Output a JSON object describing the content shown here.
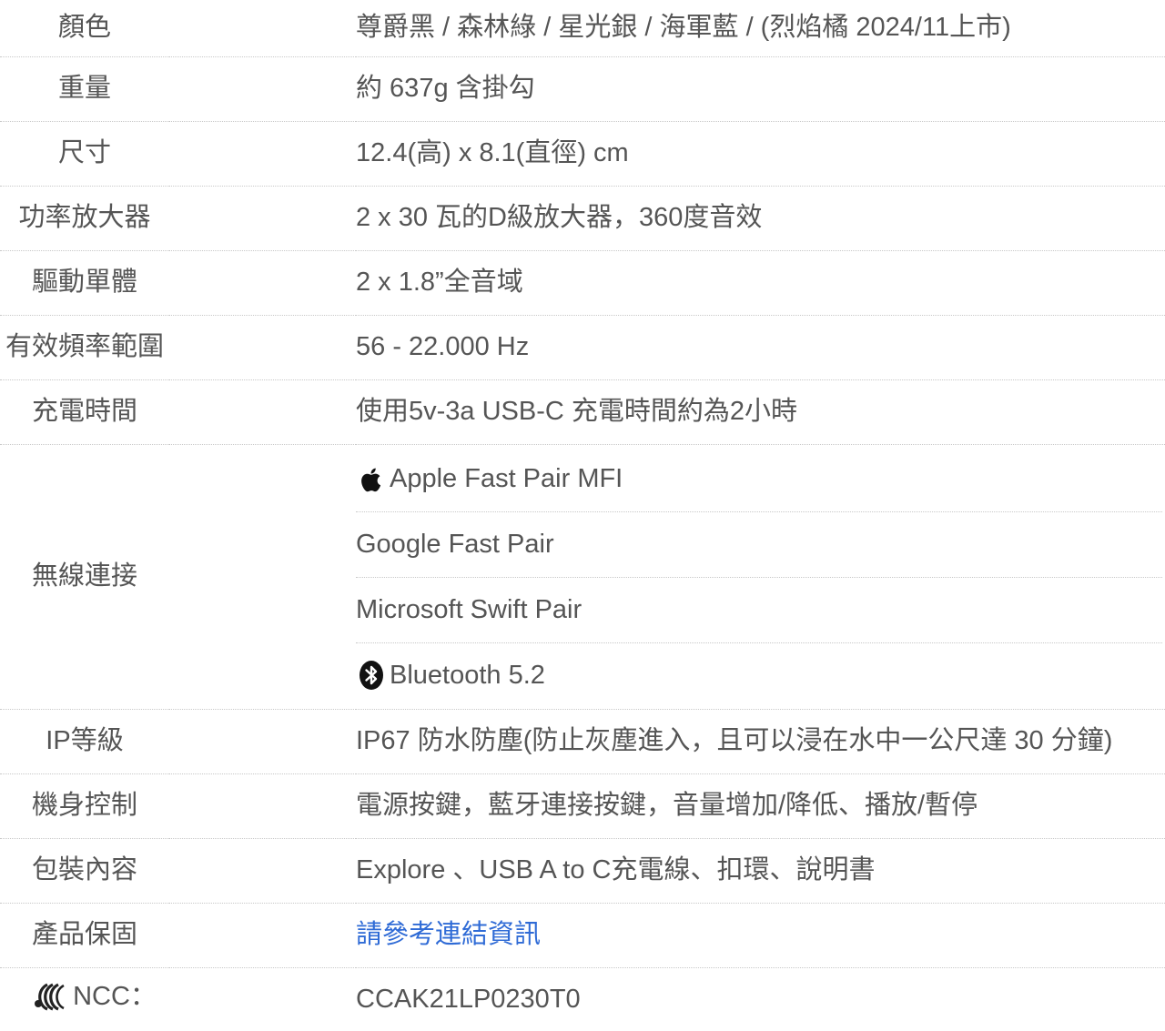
{
  "specs": [
    {
      "label": "顏色",
      "value": "尊爵黑 / 森林綠 / 星光銀 / 海軍藍 / (烈焰橘 2024/11上市)"
    },
    {
      "label": "重量",
      "value": "約 637g 含掛勾"
    },
    {
      "label": "尺寸",
      "value": "12.4(高) x 8.1(直徑) cm"
    },
    {
      "label": "功率放大器",
      "value": "2 x 30 瓦的D級放大器，360度音效"
    },
    {
      "label": "驅動單體",
      "value": "2 x 1.8”全音域"
    },
    {
      "label": "有效頻率範圍",
      "value": "56 - 22.000 Hz"
    },
    {
      "label": "充電時間",
      "value": "使用5v-3a USB-C 充電時間約為2小時"
    }
  ],
  "wireless": {
    "label": "無線連接",
    "items": [
      {
        "text": "Apple Fast Pair MFI",
        "icon": "apple-icon"
      },
      {
        "text": "Google Fast Pair"
      },
      {
        "text": "Microsoft Swift Pair"
      },
      {
        "text": "Bluetooth 5.2",
        "icon": "bluetooth-icon"
      }
    ]
  },
  "specs2": [
    {
      "label": "IP等級",
      "value": "IP67 防水防塵(防止灰塵進入，且可以浸在水中一公尺達 30 分鐘)"
    },
    {
      "label": "機身控制",
      "value": "電源按鍵，藍牙連接按鍵，音量增加/降低、播放/暫停"
    },
    {
      "label": "包裝內容",
      "value": "Explore 、USB A to C充電線、扣環、說明書"
    }
  ],
  "warranty": {
    "label": "產品保固",
    "link_text": "請參考連結資訊"
  },
  "ncc": {
    "label": "NCC：",
    "value": "CCAK21LP0230T0",
    "icon": "ncc-icon"
  },
  "colors": {
    "text": "#555555",
    "link": "#2f6bd6",
    "divider": "#c8c8c8"
  }
}
